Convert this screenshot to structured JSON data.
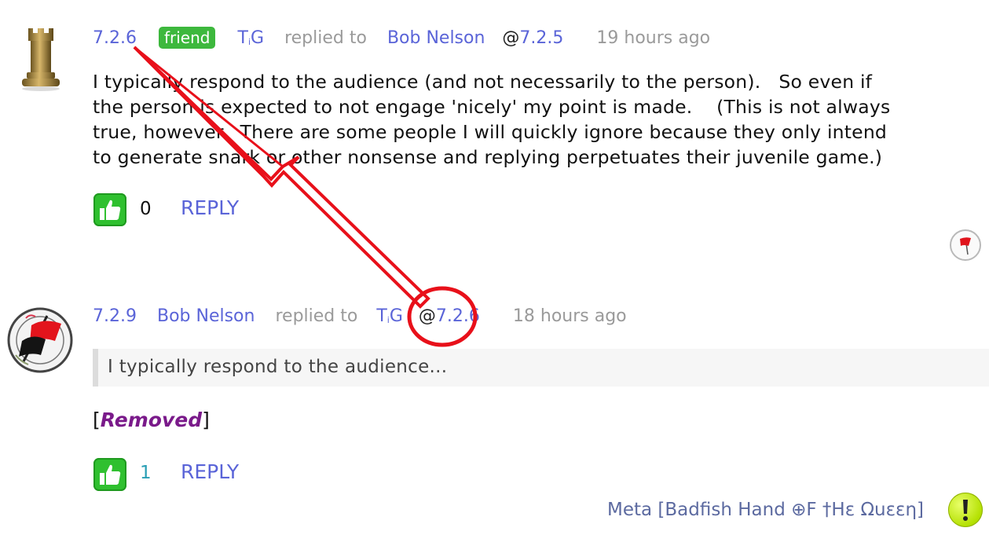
{
  "comment1": {
    "number": "7.2.6",
    "badge": "friend",
    "author_T": "T",
    "author_i": "i",
    "author_G": "G",
    "replied_to": "replied to",
    "target_name": "Bob Nelson",
    "at": "@",
    "target_number": "7.2.5",
    "time": "19 hours ago",
    "body_lines": [
      "I typically respond to the audience (and not necessarily to the person).   So even if",
      "the person is expected to not engage 'nicely' my point is made.    (This is not always",
      "true, however.  There are some people I will quickly ignore because they only intend",
      "to generate snark or other nonsense and replying perpetuates their juvenile game.)"
    ],
    "likes": "0",
    "reply": "REPLY"
  },
  "comment2": {
    "number": "7.2.9",
    "author": "Bob Nelson",
    "replied_to": "replied to",
    "target_T": "T",
    "target_i": "i",
    "target_G": "G",
    "at": "@",
    "target_number": "7.2.6",
    "time": "18 hours ago",
    "quote": "I typically respond to the audience...",
    "removed_open": "[",
    "removed": "Removed",
    "removed_close": "]",
    "likes": "1",
    "reply": "REPLY"
  },
  "footer": {
    "meta_label": "Meta [Badfish Hand ⊕F †Hε Ωuεεη]"
  },
  "icons": {
    "avatar1": "chess-rook-icon",
    "avatar2": "antifa-flag-avatar-icon",
    "thumb": "thumbs-up-icon",
    "flag": "flag-icon",
    "alert": "exclamation-icon"
  },
  "colors": {
    "link": "#5a64d8",
    "badge": "#3db83d",
    "removed": "#7a1a8a",
    "annotation": "#e8101a"
  }
}
